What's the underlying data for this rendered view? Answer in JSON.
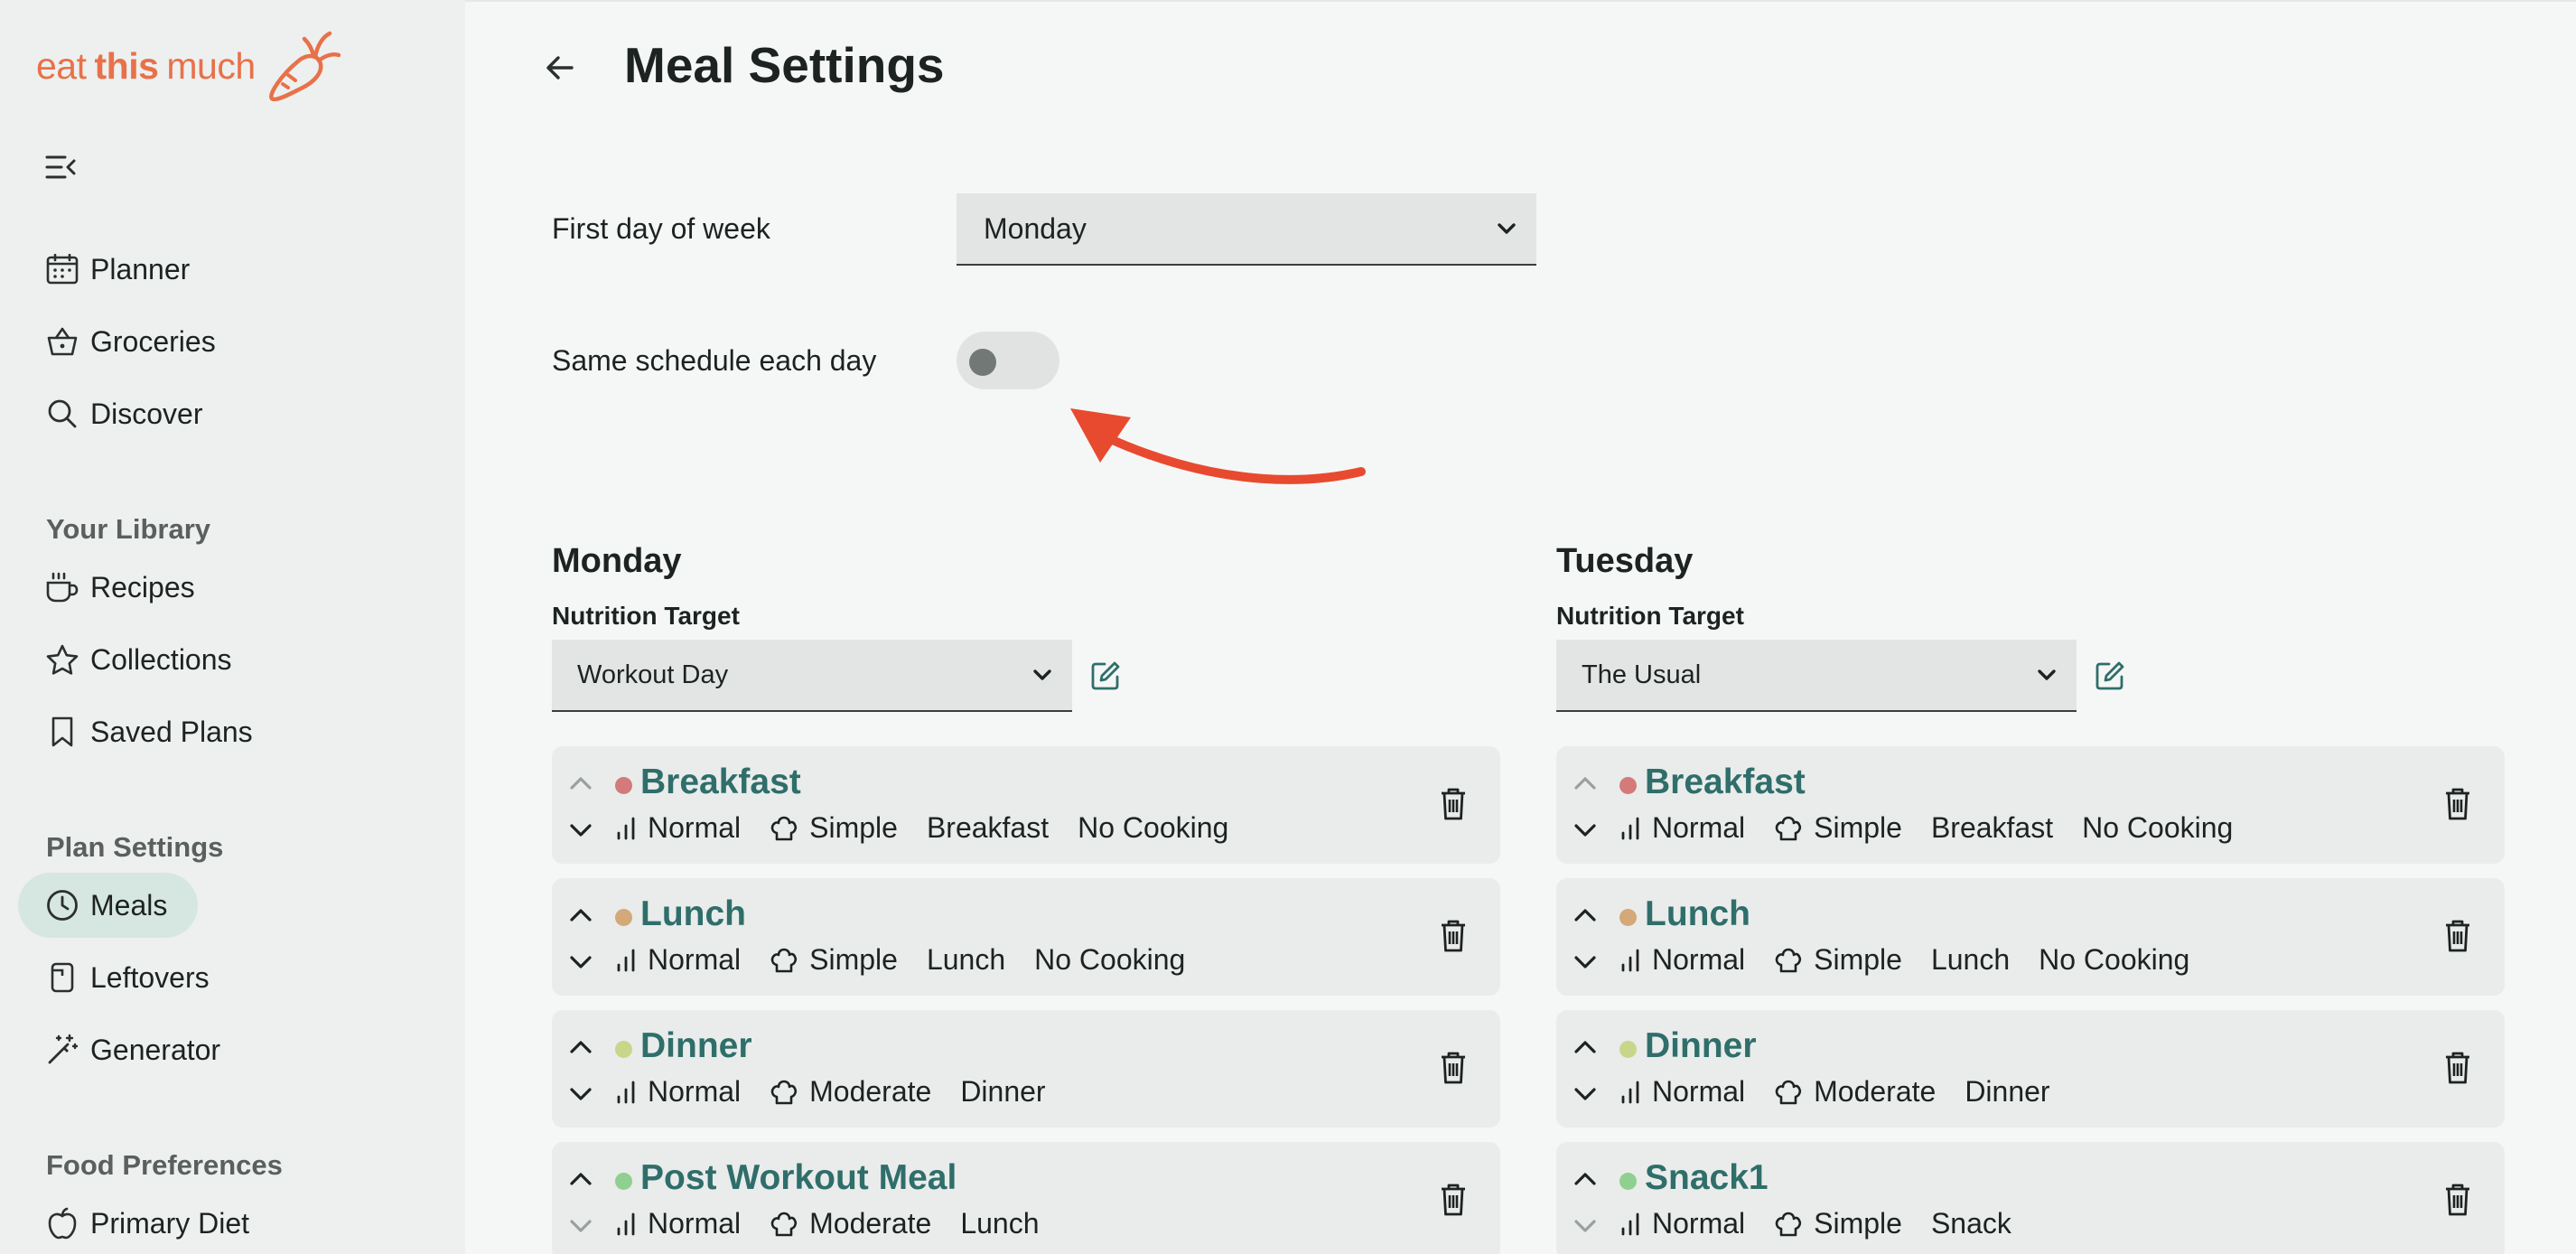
{
  "app": {
    "logo_prefix": "eat",
    "logo_bold": "this",
    "logo_suffix": "much",
    "accent": "#e8714a",
    "teal": "#2f6e6a"
  },
  "sidebar": {
    "nav": [
      {
        "label": "Planner",
        "icon": "calendar-icon"
      },
      {
        "label": "Groceries",
        "icon": "basket-icon"
      },
      {
        "label": "Discover",
        "icon": "search-icon"
      }
    ],
    "library_heading": "Your Library",
    "library": [
      {
        "label": "Recipes",
        "icon": "cup-icon"
      },
      {
        "label": "Collections",
        "icon": "star-icon"
      },
      {
        "label": "Saved Plans",
        "icon": "bookmark-icon"
      }
    ],
    "plan_heading": "Plan Settings",
    "plan": [
      {
        "label": "Meals",
        "icon": "clock-icon",
        "active": true
      },
      {
        "label": "Leftovers",
        "icon": "container-icon"
      },
      {
        "label": "Generator",
        "icon": "wand-icon"
      }
    ],
    "food_heading": "Food Preferences",
    "food": [
      {
        "label": "Primary Diet",
        "icon": "apple-icon"
      }
    ]
  },
  "main": {
    "title": "Meal Settings",
    "first_day_label": "First day of week",
    "first_day_value": "Monday",
    "same_schedule_label": "Same schedule each day",
    "same_schedule_on": false,
    "nutrition_target_label": "Nutrition Target",
    "days": [
      {
        "name": "Monday",
        "target": "Workout Day",
        "meals": [
          {
            "name": "Breakfast",
            "dot": "#d47a7a",
            "size": "Normal",
            "complexity": "Simple",
            "type": "Breakfast",
            "cooking": "No Cooking"
          },
          {
            "name": "Lunch",
            "dot": "#d4a878",
            "size": "Normal",
            "complexity": "Simple",
            "type": "Lunch",
            "cooking": "No Cooking"
          },
          {
            "name": "Dinner",
            "dot": "#c7d68a",
            "size": "Normal",
            "complexity": "Moderate",
            "type": "Dinner",
            "cooking": ""
          },
          {
            "name": "Post Workout Meal",
            "dot": "#8fcf8f",
            "size": "Normal",
            "complexity": "Moderate",
            "type": "Lunch",
            "cooking": ""
          }
        ]
      },
      {
        "name": "Tuesday",
        "target": "The Usual",
        "meals": [
          {
            "name": "Breakfast",
            "dot": "#d47a7a",
            "size": "Normal",
            "complexity": "Simple",
            "type": "Breakfast",
            "cooking": "No Cooking"
          },
          {
            "name": "Lunch",
            "dot": "#d4a878",
            "size": "Normal",
            "complexity": "Simple",
            "type": "Lunch",
            "cooking": "No Cooking"
          },
          {
            "name": "Dinner",
            "dot": "#c7d68a",
            "size": "Normal",
            "complexity": "Moderate",
            "type": "Dinner",
            "cooking": ""
          },
          {
            "name": "Snack1",
            "dot": "#8fcf8f",
            "size": "Normal",
            "complexity": "Simple",
            "type": "Snack",
            "cooking": ""
          }
        ]
      }
    ]
  }
}
